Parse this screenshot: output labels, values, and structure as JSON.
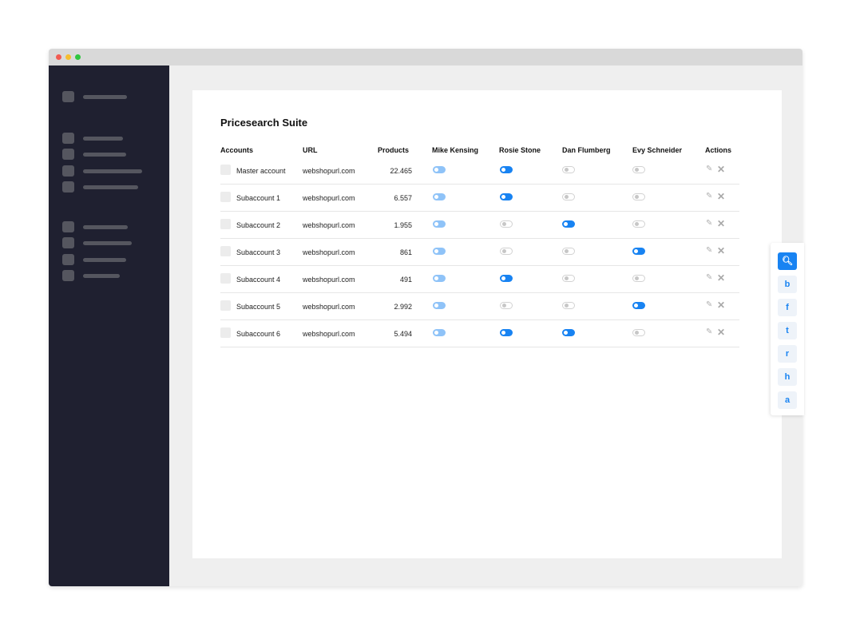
{
  "window": {
    "controls": [
      "close",
      "minimize",
      "maximize"
    ],
    "colors": {
      "close": "#f25b52",
      "minimize": "#f6be2f",
      "maximize": "#2fc63f"
    }
  },
  "sidebar": {
    "background": "#1f2030",
    "placeholder_color": "#55565f",
    "item_count": 11
  },
  "page": {
    "title": "Pricesearch Suite"
  },
  "table": {
    "headers": {
      "accounts": "Accounts",
      "url": "URL",
      "products": "Products",
      "mike": "Mike Kensing",
      "rosie": "Rosie Stone",
      "dan": "Dan Flumberg",
      "evy": "Evy Schneider",
      "actions": "Actions"
    },
    "rows": [
      {
        "account": "Master account",
        "url": "webshopurl.com",
        "products": "22.465",
        "toggles": [
          "light",
          "on",
          "off",
          "off"
        ]
      },
      {
        "account": "Subaccount 1",
        "url": "webshopurl.com",
        "products": "6.557",
        "toggles": [
          "light",
          "on",
          "off",
          "off"
        ]
      },
      {
        "account": "Subaccount 2",
        "url": "webshopurl.com",
        "products": "1.955",
        "toggles": [
          "light",
          "off",
          "on",
          "off"
        ]
      },
      {
        "account": "Subaccount 3",
        "url": "webshopurl.com",
        "products": "861",
        "toggles": [
          "light",
          "off",
          "off",
          "on"
        ]
      },
      {
        "account": "Subaccount 4",
        "url": "webshopurl.com",
        "products": "491",
        "toggles": [
          "light",
          "on",
          "off",
          "off"
        ]
      },
      {
        "account": "Subaccount 5",
        "url": "webshopurl.com",
        "products": "2.992",
        "toggles": [
          "light",
          "off",
          "off",
          "on"
        ]
      },
      {
        "account": "Subaccount 6",
        "url": "webshopurl.com",
        "products": "5.494",
        "toggles": [
          "light",
          "on",
          "on",
          "off"
        ]
      }
    ],
    "action_icons": [
      "edit-icon",
      "delete-icon"
    ]
  },
  "share_bar": {
    "accent": "#1883f2",
    "buttons": [
      {
        "label": "🔍︎",
        "icon": "search-zoom-icon",
        "active": true
      },
      {
        "label": "b",
        "icon": "b-icon",
        "active": false
      },
      {
        "label": "f",
        "icon": "f-icon",
        "active": false
      },
      {
        "label": "t",
        "icon": "t-icon",
        "active": false
      },
      {
        "label": "r",
        "icon": "r-icon",
        "active": false
      },
      {
        "label": "h",
        "icon": "h-icon",
        "active": false
      },
      {
        "label": "a",
        "icon": "a-icon",
        "active": false
      }
    ]
  }
}
